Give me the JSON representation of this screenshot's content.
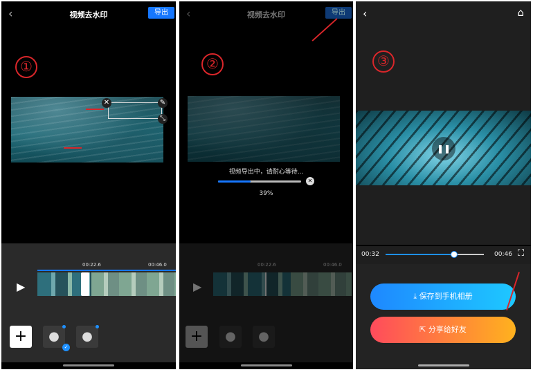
{
  "panel1": {
    "step": "①",
    "title": "视频去水印",
    "export_label": "导出",
    "back_icon": "‹",
    "times": [
      "00:22.6",
      "00:46.0"
    ],
    "play_icon": "▶",
    "add_icon": "+",
    "close_icon": "✕",
    "edit_icon": "✎",
    "resize_icon": "⤡",
    "drop_icon": "💧"
  },
  "panel2": {
    "step": "②",
    "title": "视频去水印",
    "export_label": "导出",
    "back_icon": "‹",
    "progress_text": "视频导出中，请耐心等待...",
    "progress_percent": "39%",
    "progress_value": 0.39,
    "times": [
      "00:22.6",
      "00:46.0"
    ],
    "play_icon": "▶",
    "add_icon": "+",
    "drop_icon": "💧",
    "cancel_icon": "✕"
  },
  "panel3": {
    "step": "③",
    "back_icon": "‹",
    "home_icon": "⌂",
    "pause_icon": "❚❚",
    "current_time": "00:32",
    "total_time": "00:46",
    "seek_value": 0.7,
    "fullscreen_icon": "⛶",
    "save_label": "保存到手机相册",
    "save_icon": "⤓",
    "share_label": "分享给好友",
    "share_icon": "⇱"
  },
  "colors": {
    "accent": "#1677ff",
    "annotation": "#d9262a",
    "save_gradient_from": "#1e88ff",
    "save_gradient_to": "#1ec8ff",
    "share_gradient_from": "#ff4b5c",
    "share_gradient_to": "#ffb21e"
  }
}
